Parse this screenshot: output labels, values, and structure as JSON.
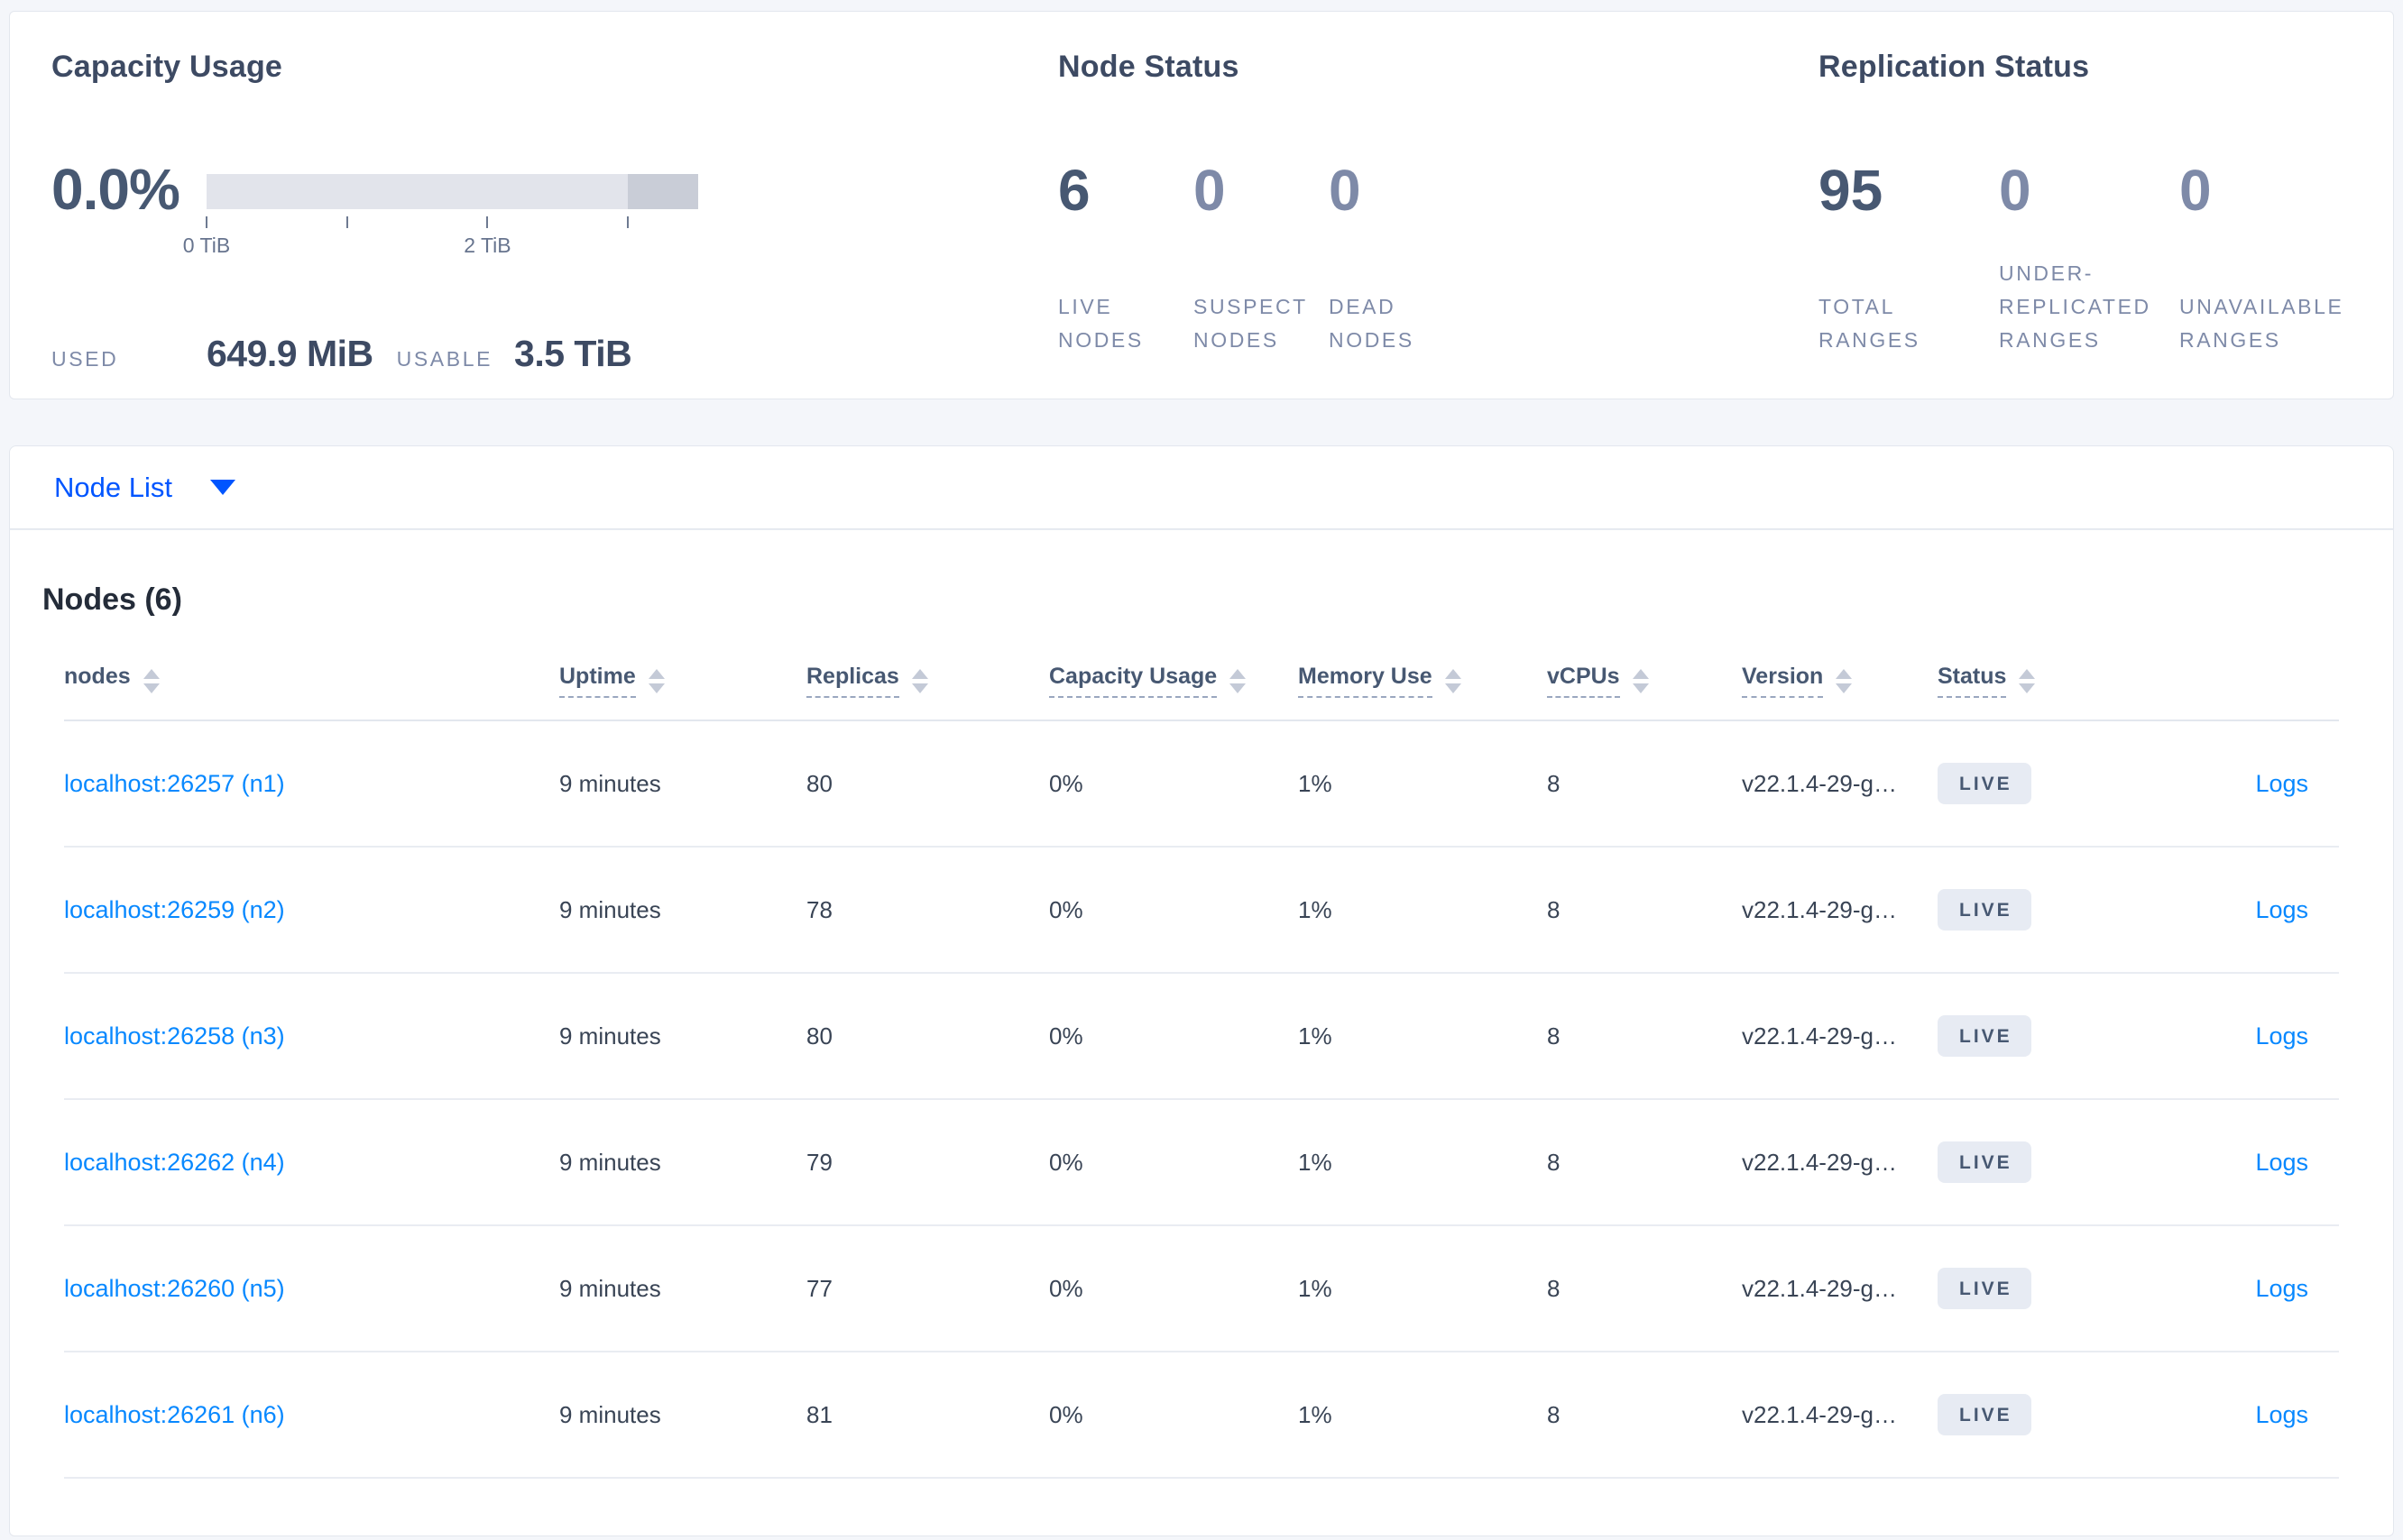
{
  "summary": {
    "capacity": {
      "title": "Capacity Usage",
      "percent": "0.0%",
      "used_label": "USED",
      "used_value": "649.9 MiB",
      "usable_label": "USABLE",
      "usable_value": "3.5 TiB",
      "bar": {
        "range_tib": [
          0,
          3.5
        ],
        "tick_interval_tib": 1,
        "dark_segment_tib": [
          3.0,
          3.5
        ],
        "light_color": "#e2e4eb",
        "dark_color": "#c9cdd7"
      },
      "axis_ticks": [
        {
          "label": "0 TiB",
          "position_tib": 0
        },
        {
          "label": "2 TiB",
          "position_tib": 2
        }
      ]
    },
    "node_status": {
      "title": "Node Status",
      "metrics": [
        {
          "value": "6",
          "label": "LIVE\nNODES",
          "emphasized": true
        },
        {
          "value": "0",
          "label": "SUSPECT\nNODES",
          "emphasized": false
        },
        {
          "value": "0",
          "label": "DEAD\nNODES",
          "emphasized": false
        }
      ]
    },
    "replication_status": {
      "title": "Replication Status",
      "metrics": [
        {
          "value": "95",
          "label": "TOTAL\nRANGES",
          "emphasized": true
        },
        {
          "value": "0",
          "label": "UNDER-\nREPLICATED\nRANGES",
          "emphasized": false
        },
        {
          "value": "0",
          "label": "UNAVAILABLE\nRANGES",
          "emphasized": false
        }
      ]
    }
  },
  "view_selector": {
    "label": "Node List"
  },
  "nodes_table": {
    "title": "Nodes (6)",
    "columns": [
      {
        "label": "nodes",
        "sortable": true,
        "filter_underline": false
      },
      {
        "label": "Uptime",
        "sortable": true,
        "filter_underline": true
      },
      {
        "label": "Replicas",
        "sortable": true,
        "filter_underline": true
      },
      {
        "label": "Capacity Usage",
        "sortable": true,
        "filter_underline": true
      },
      {
        "label": "Memory Use",
        "sortable": true,
        "filter_underline": true
      },
      {
        "label": "vCPUs",
        "sortable": true,
        "filter_underline": true
      },
      {
        "label": "Version",
        "sortable": true,
        "filter_underline": true
      },
      {
        "label": "Status",
        "sortable": true,
        "filter_underline": true
      },
      {
        "label": "",
        "sortable": false,
        "filter_underline": false
      }
    ],
    "rows": [
      {
        "node": "localhost:26257 (n1)",
        "uptime": "9 minutes",
        "replicas": "80",
        "capacity_usage": "0%",
        "memory_use": "1%",
        "vcpus": "8",
        "version": "v22.1.4-29-g…",
        "status": "LIVE",
        "logs_label": "Logs"
      },
      {
        "node": "localhost:26259 (n2)",
        "uptime": "9 minutes",
        "replicas": "78",
        "capacity_usage": "0%",
        "memory_use": "1%",
        "vcpus": "8",
        "version": "v22.1.4-29-g…",
        "status": "LIVE",
        "logs_label": "Logs"
      },
      {
        "node": "localhost:26258 (n3)",
        "uptime": "9 minutes",
        "replicas": "80",
        "capacity_usage": "0%",
        "memory_use": "1%",
        "vcpus": "8",
        "version": "v22.1.4-29-g…",
        "status": "LIVE",
        "logs_label": "Logs"
      },
      {
        "node": "localhost:26262 (n4)",
        "uptime": "9 minutes",
        "replicas": "79",
        "capacity_usage": "0%",
        "memory_use": "1%",
        "vcpus": "8",
        "version": "v22.1.4-29-g…",
        "status": "LIVE",
        "logs_label": "Logs"
      },
      {
        "node": "localhost:26260 (n5)",
        "uptime": "9 minutes",
        "replicas": "77",
        "capacity_usage": "0%",
        "memory_use": "1%",
        "vcpus": "8",
        "version": "v22.1.4-29-g…",
        "status": "LIVE",
        "logs_label": "Logs"
      },
      {
        "node": "localhost:26261 (n6)",
        "uptime": "9 minutes",
        "replicas": "81",
        "capacity_usage": "0%",
        "memory_use": "1%",
        "vcpus": "8",
        "version": "v22.1.4-29-g…",
        "status": "LIVE",
        "logs_label": "Logs"
      }
    ]
  },
  "colors": {
    "accent_blue": "#0055ff",
    "link_blue": "#0788ff",
    "slate_dark": "#475872",
    "muted": "#7e8aa8",
    "badge_bg": "#e7ebf3",
    "bar_light": "#e2e4eb",
    "bar_dark": "#c9cdd7",
    "page_bg": "#f4f6fa"
  }
}
